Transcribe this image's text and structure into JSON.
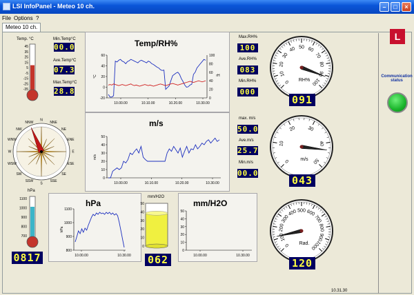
{
  "window": {
    "title": "LSI InfoPanel - Meteo 10 ch."
  },
  "menu": {
    "file": "File",
    "options": "Options",
    "help": "?"
  },
  "tab": {
    "label": "Meteo 10 ch."
  },
  "temp": {
    "thermo_label": "Temp. °C",
    "thermo_ticks": [
      "45",
      "35",
      "25",
      "15",
      "5",
      "-5",
      "-15",
      "-25",
      "-35"
    ],
    "thermo_fill": 0.55,
    "min_label": "Min.Temp°C",
    "min_value": "00.0",
    "ave_label": "Ave.Temp°C",
    "ave_value": "07.3",
    "max_label": "Max.Temp°C",
    "max_value": "28.8"
  },
  "chart_temp": {
    "title": "Temp/RH%",
    "ylabel_left": "°C",
    "ylabel_right": "rH"
  },
  "humidity": {
    "max_label": "Max.RH%",
    "max_value": "100",
    "ave_label": "Ave.RH%",
    "ave_value": "083",
    "min_label": "Min.RH%",
    "min_value": "000",
    "gauge_unit": "RH%",
    "gauge_ticks": [
      "0",
      "10",
      "20",
      "30",
      "40",
      "50",
      "60",
      "70",
      "80",
      "90",
      "100"
    ],
    "gauge_value": 91,
    "display_value": "091"
  },
  "wind": {
    "compass_labels": [
      "N",
      "NNE",
      "NE",
      "ENE",
      "E",
      "ESE",
      "SE",
      "SSE",
      "S",
      "SSW",
      "SW",
      "WSW",
      "W",
      "WNW",
      "NW",
      "NNW"
    ],
    "direction_deg": 337,
    "max_label": "max. m/s",
    "max_value": "50.0",
    "ave_label": "Ave.m/s",
    "ave_value": "25.7",
    "min_label": "Min.m/s",
    "min_value": "00.0",
    "gauge_unit": "m/s",
    "gauge_ticks": [
      "0",
      "10",
      "20",
      "30",
      "40",
      "50"
    ],
    "gauge_value": 43,
    "display_value": "043"
  },
  "chart_wind": {
    "title": "m/s",
    "ylabel": "m/s"
  },
  "pressure": {
    "thermo_label": "hPa",
    "thermo_ticks": [
      "1100",
      "1000",
      "900",
      "800",
      "700"
    ],
    "thermo_fill": 0.75,
    "display_value": "0817"
  },
  "chart_pressure": {
    "title": "hPa",
    "ylabel": "hPa"
  },
  "rain": {
    "tank_label": "mm/H2O",
    "tank_ticks": [
      "50",
      "40",
      "30",
      "20",
      "10",
      "0"
    ],
    "tank_fill": 0.77,
    "display_value": "062"
  },
  "chart_rain": {
    "title": "mm/H2O"
  },
  "radiation": {
    "gauge_unit": "Rad.",
    "gauge_ticks": [
      "0",
      "100",
      "200",
      "300",
      "400",
      "500",
      "600",
      "700",
      "800",
      "900",
      "1000"
    ],
    "gauge_value": 120,
    "display_value": "120"
  },
  "status": {
    "label": "Communication status",
    "color": "#1ab52b"
  },
  "statusbar": {
    "time": "10.31.30"
  },
  "chart_data": [
    {
      "type": "line",
      "title": "Temp/RH%",
      "x_ticks": [
        "10.00.00",
        "10.10.00",
        "10.20.00",
        "10.30.00"
      ],
      "ylim_left": [
        -20,
        60
      ],
      "yticks_left": [
        "60",
        "40",
        "20",
        "0",
        "-20"
      ],
      "ylim_right": [
        0,
        100
      ],
      "yticks_right": [
        "100",
        "80",
        "60",
        "40",
        "20",
        "0"
      ],
      "series": [
        {
          "color": "#1c2fbf",
          "axis": "right",
          "values": [
            8,
            2,
            2,
            5,
            86,
            84,
            88,
            90,
            86,
            84,
            80,
            85,
            87,
            90,
            88,
            86,
            84,
            82,
            86,
            88,
            86,
            84,
            82,
            86,
            84,
            80,
            78,
            75,
            72,
            70,
            66,
            64,
            65,
            20,
            24,
            28,
            40,
            52,
            55,
            58,
            60,
            55,
            45,
            38,
            30,
            25,
            26,
            30,
            32,
            55,
            60,
            70,
            75,
            80,
            85,
            90,
            88
          ]
        },
        {
          "color": "#d02020",
          "axis": "left",
          "values": [
            4,
            5,
            4,
            6,
            5,
            4,
            3,
            4,
            5,
            4,
            3,
            4,
            5,
            6,
            4,
            3,
            4,
            3,
            2,
            3,
            4,
            5,
            4,
            3,
            4,
            3,
            2,
            3,
            4,
            5,
            6,
            5,
            4,
            3,
            4,
            5,
            6,
            7,
            6,
            5,
            4,
            5,
            6,
            7,
            8,
            9,
            10,
            11,
            10,
            9,
            10,
            11,
            12,
            11,
            10,
            11,
            12
          ]
        }
      ]
    },
    {
      "type": "line",
      "title": "m/s",
      "x_ticks": [
        "10.00.00",
        "10.10.00",
        "10.20.00",
        "10.30.00"
      ],
      "ylim": [
        0,
        50
      ],
      "yticks": [
        "50",
        "40",
        "30",
        "20",
        "10",
        "0"
      ],
      "series": [
        {
          "color": "#1c2fbf",
          "values": [
            0,
            0,
            8,
            10,
            12,
            10,
            12,
            20,
            18,
            22,
            30,
            28,
            32,
            35,
            30,
            38,
            25,
            22,
            20,
            20,
            20,
            20,
            20,
            20,
            20,
            20,
            20,
            30,
            35,
            32,
            38,
            34,
            30,
            36,
            25,
            32,
            38,
            30,
            35,
            34,
            40,
            35,
            38,
            42,
            40,
            44,
            46,
            42,
            45,
            48,
            44,
            46
          ]
        }
      ]
    },
    {
      "type": "line",
      "title": "hPa",
      "x_ticks": [
        "10.00.00",
        "10.30.00"
      ],
      "ylim": [
        800,
        1100
      ],
      "yticks": [
        "1100",
        "1000",
        "900",
        "800"
      ],
      "series": [
        {
          "color": "#1c2fbf",
          "values": [
            860,
            900,
            940,
            920,
            955,
            930,
            960,
            945,
            980,
            1010,
            1040,
            1060,
            1050,
            1070,
            1060,
            1075,
            1065,
            1070,
            1060,
            1075,
            1065,
            1075,
            1060,
            1070,
            1055,
            1065,
            1050,
            1000,
            940,
            880,
            820
          ]
        }
      ]
    },
    {
      "type": "line",
      "title": "mm/H2O",
      "x_ticks": [
        "10.00.00",
        "10.30.00"
      ],
      "ylim": [
        0,
        50
      ],
      "yticks": [
        "50",
        "40",
        "30",
        "20",
        "10",
        "0"
      ],
      "series": []
    }
  ]
}
